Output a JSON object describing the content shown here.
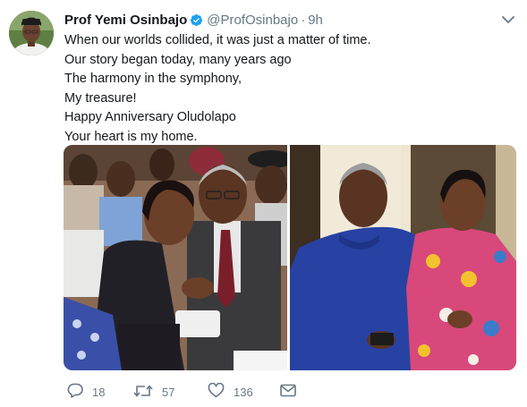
{
  "tweet": {
    "author_name": "Prof Yemi Osinbajo",
    "author_handle": "@ProfOsinbajo",
    "separator": "·",
    "time": "9h",
    "lines": [
      "When our worlds collided, it was just a matter of time.",
      "Our story began today, many years ago",
      "The harmony in the symphony,",
      "My treasure!",
      "Happy Anniversary Oludolapo",
      "Your heart is my home."
    ]
  },
  "actions": {
    "reply_count": "18",
    "retweet_count": "57",
    "like_count": "136"
  },
  "icons": {
    "verified": "verified-badge-icon",
    "caret": "chevron-down-icon",
    "reply": "reply-icon",
    "retweet": "retweet-icon",
    "like": "heart-icon",
    "message": "envelope-icon"
  },
  "colors": {
    "accent": "#1da1f2",
    "text": "#14171a",
    "secondary": "#657786"
  }
}
